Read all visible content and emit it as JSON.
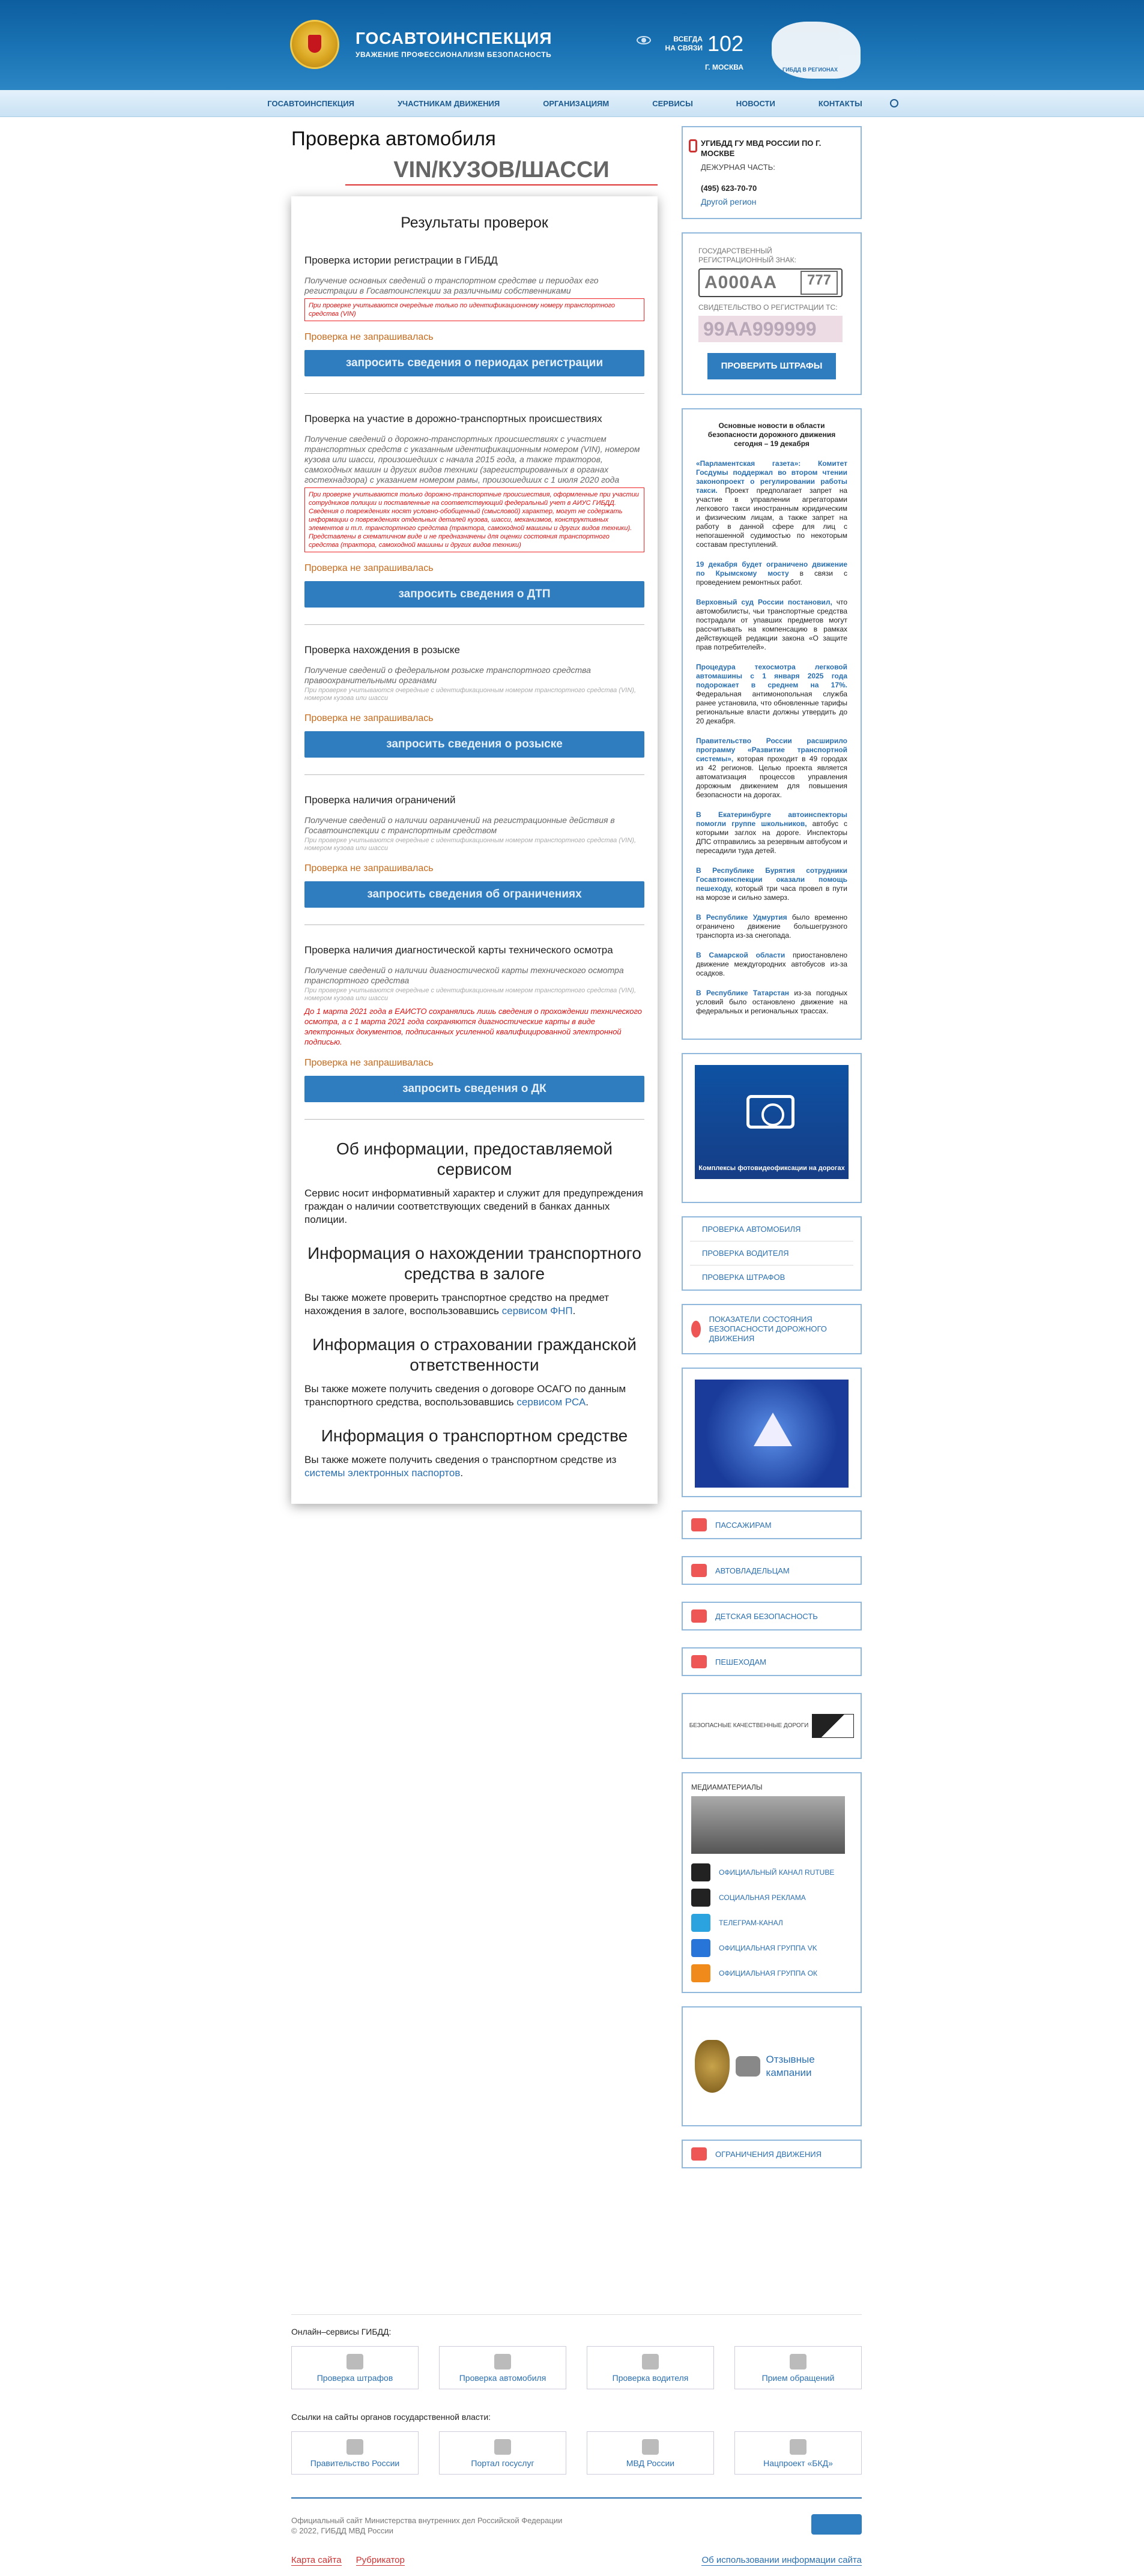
{
  "header": {
    "brand": "ГОСАВТОИНСПЕКЦИЯ",
    "slogan": "УВАЖЕНИЕ ПРОФЕССИОНАЛИЗМ БЕЗОПАСНОСТЬ",
    "always": "ВСЕГДА\nНА СВЯЗИ",
    "phone": "102",
    "city": "Г. МОСКВА",
    "map_label": "ГИБДД В РЕГИОНАХ"
  },
  "nav": [
    "ГОСАВТОИНСПЕКЦИЯ",
    "УЧАСТНИКАМ ДВИЖЕНИЯ",
    "ОРГАНИЗАЦИЯМ",
    "СЕРВИСЫ",
    "НОВОСТИ",
    "КОНТАКТЫ"
  ],
  "page": {
    "title": "Проверка автомобиля",
    "vin": "VIN/КУЗОВ/ШАССИ",
    "results_title": "Результаты проверок"
  },
  "checks": [
    {
      "title": "Проверка истории регистрации в ГИБДД",
      "desc": "Получение основных сведений о транспортном средстве и периодах его регистрации в Госавтоинспекции за различными собственниками",
      "note": "",
      "warn": "При проверке учитываются очередные только по идентификационному номеру транспортного средства (VIN)",
      "red": "",
      "status": "Проверка не запрашивалась",
      "button": "запросить сведения о периодах регистрации"
    },
    {
      "title": "Проверка на участие в дорожно-транспортных происшествиях",
      "desc": "Получение сведений о дорожно-транспортных происшествиях с участием транспортных средств с указанным идентификационным номером (VIN), номером кузова или шасси, произошедших с начала 2015 года, а также тракторов, самоходных машин и других видов техники (зарегистрированных в органах гостехнадзора) с указанием номером рамы, произошедших с 1 июля 2020 года",
      "note": "",
      "warn": "При проверке учитываются только дорожно-транспортные происшествия, оформленные при участии сотрудников полиции и поставленные на соответствующий федеральный учет в АИУС ГИБДД. Сведения о повреждениях носят условно-обобщенный (смысловой) характер, могут не содержать информации о повреждениях отдельных деталей кузова, шасси, механизмов, конструктивных элементов и т.п. транспортного средства (трактора, самоходной машины и других видов техники). Представлены в схематичном виде и не предназначены для оценки состояния транспортного средства (трактора, самоходной машины и других видов техники)",
      "red": "",
      "status": "Проверка не запрашивалась",
      "button": "запросить сведения о ДТП"
    },
    {
      "title": "Проверка нахождения в розыске",
      "desc": "Получение сведений о федеральном розыске транспортного средства правоохранительными органами",
      "note": "При проверке учитываются очередные с идентификационным номером транспортного средства (VIN), номером кузова или шасси",
      "warn": "",
      "red": "",
      "status": "Проверка не запрашивалась",
      "button": "запросить сведения о розыске"
    },
    {
      "title": "Проверка наличия ограничений",
      "desc": "Получение сведений о наличии ограничений на регистрационные действия в Госавтоинспекции с транспортным средством",
      "note": "При проверке учитываются очередные с идентификационным номером транспортного средства (VIN), номером кузова или шасси",
      "warn": "",
      "red": "",
      "status": "Проверка не запрашивалась",
      "button": "запросить сведения об ограничениях"
    },
    {
      "title": "Проверка наличия диагностической карты технического осмотра",
      "desc": "Получение сведений о наличии диагностической карты технического осмотра транспортного средства",
      "note": "При проверке учитываются очередные с идентификационным номером транспортного средства (VIN), номером кузова или шасси",
      "warn": "",
      "red": "До 1 марта 2021 года в ЕАИСТО сохранялись лишь сведения о прохождении технического осмотра, а с 1 марта 2021 года сохраняются диагностические карты в виде электронных документов, подписанных усиленной квалифицированной электронной подписью.",
      "status": "Проверка не запрашивалась",
      "button": "запросить сведения о ДК"
    }
  ],
  "info": {
    "h1": "Об информации, предоставляемой сервисом",
    "p1": "Сервис носит информативный характер и служит для предупреждения граждан о наличии соответствующих сведений в банках данных полиции.",
    "h2": "Информация о нахождении транспортного средства в залоге",
    "p2": "Вы также можете проверить транспортное средство на предмет нахождения в залоге, воспользовавшись ",
    "l2": "сервисом ФНП",
    "h3": "Информация о страховании гражданской ответственности",
    "p3": "Вы также можете получить сведения о договоре ОСАГО по данным транспортного средства, воспользовавшись ",
    "l3": "сервисом РСА",
    "h4": "Информация о транспортном средстве",
    "p4": "Вы также можете получить сведения о транспортном средстве из ",
    "l4": "системы электронных паспортов"
  },
  "contact": {
    "title": "УГИБДД ГУ МВД РОССИИ ПО Г. МОСКВЕ",
    "label": "ДЕЖУРНАЯ ЧАСТЬ:",
    "phone": "(495) 623-70-70",
    "other": "Другой регион"
  },
  "fines": {
    "reg_label": "ГОСУДАРСТВЕННЫЙ РЕГИСТРАЦИОННЫЙ ЗНАК:",
    "plate": "А000АА",
    "region": "777",
    "cert_label": "СВИДЕТЕЛЬСТВО О РЕГИСТРАЦИИ ТС:",
    "cert": "99АА999999",
    "button": "ПРОВЕРИТЬ ШТРАФЫ"
  },
  "news": {
    "title": "Основные новости в области безопасности дорожного движения сегодня – 19 декабря",
    "items": [
      {
        "b": "«Парламентская газета»: Комитет Госдумы поддержал во втором чтении законопроект о регулировании работы такси.",
        "t": " Проект предполагает запрет на участие в управлении агрегаторами легкового такси иностранным юридическим и физическим лицам, а также запрет на работу в данной сфере для лиц с непогашенной судимостью по некоторым составам преступлений."
      },
      {
        "b": "19 декабря будет ограничено движение по Крымскому мосту",
        "t": " в связи с проведением ремонтных работ."
      },
      {
        "b": "Верховный суд России постановил,",
        "t": " что автомобилисты, чьи транспортные средства пострадали от упавших предметов могут рассчитывать на компенсацию в рамках действующей редакции закона «О защите прав потребителей»."
      },
      {
        "b": "Процедура техосмотра легковой автомашины с 1 января 2025 года подорожает в среднем на 17%.",
        "t": " Федеральная антимонопольная служба ранее установила, что обновленные тарифы региональные власти должны утвердить до 20 декабря."
      },
      {
        "b": "Правительство России расширило программу «Развитие транспортной системы»,",
        "t": " которая проходит в 49 городах из 42 регионов. Целью проекта является автоматизация процессов управления дорожным движением для повышения безопасности на дорогах."
      },
      {
        "b": "В Екатеринбурге автоинспекторы помогли группе школьников,",
        "t": " автобус с которыми заглох на дороге. Инспекторы ДПС отправились за резервным автобусом и пересадили туда детей."
      },
      {
        "b": "В Республике Бурятия сотрудники Госавтоинспекции оказали помощь пешеходу,",
        "t": " который три часа провел в пути на морозе и сильно замерз."
      },
      {
        "b": "В Республике Удмуртия",
        "t": " было временно ограничено движение большегрузного транспорта из-за снегопада."
      },
      {
        "b": "В Самарской области",
        "t": " приостановлено движение междугородних автобусов из-за осадков."
      },
      {
        "b": "В Республике Татарстан",
        "t": " из-за погодных условий было остановлено движение на федеральных и региональных трассах."
      }
    ]
  },
  "foto_banner": "Комплексы фотовидеофиксации на дорогах",
  "quick_links": [
    "ПРОВЕРКА АВТОМОБИЛЯ",
    "ПРОВЕРКА ВОДИТЕЛЯ",
    "ПРОВЕРКА ШТРАФОВ"
  ],
  "indicators": "ПОКАЗАТЕЛИ СОСТОЯНИЯ БЕЗОПАСНОСТИ ДОРОЖНОГО ДВИЖЕНИЯ",
  "sections": [
    "ПАССАЖИРАМ",
    "АВТОВЛАДЕЛЬЦАМ",
    "ДЕТСКАЯ БЕЗОПАСНОСТЬ",
    "ПЕШЕХОДАМ"
  ],
  "roads": "БЕЗОПАСНЫЕ КАЧЕСТВЕННЫЕ ДОРОГИ",
  "media": {
    "label": "МЕДИАМАТЕРИАЛЫ",
    "items": [
      "ОФИЦИАЛЬНЫЙ КАНАЛ RUTUBE",
      "СОЦИАЛЬНАЯ РЕКЛАМА",
      "ТЕЛЕГРАМ-КАНАЛ",
      "ОФИЦИАЛЬНАЯ ГРУППА VK",
      "ОФИЦИАЛЬНАЯ ГРУППА ОК"
    ]
  },
  "campaigns": "Отзывные кампании",
  "restrictions": "ОГРАНИЧЕНИЯ ДВИЖЕНИЯ",
  "footer": {
    "online_label": "Онлайн–сервисы ГИБДД:",
    "online": [
      "Проверка штрафов",
      "Проверка автомобиля",
      "Проверка водителя",
      "Прием обращений"
    ],
    "gov_label": "Ссылки на сайты органов государственной власти:",
    "gov": [
      "Правительство России",
      "Портал госуслуг",
      "МВД России",
      "Нацпроект «БКД»"
    ],
    "copy1": "Официальный сайт Министерства внутренних дел Российской Федерации",
    "copy2": "© 2022, ГИБДД МВД России",
    "sitemap": "Карта сайта",
    "rubricator": "Рубрикатор",
    "about": "Об использовании информации сайта"
  }
}
